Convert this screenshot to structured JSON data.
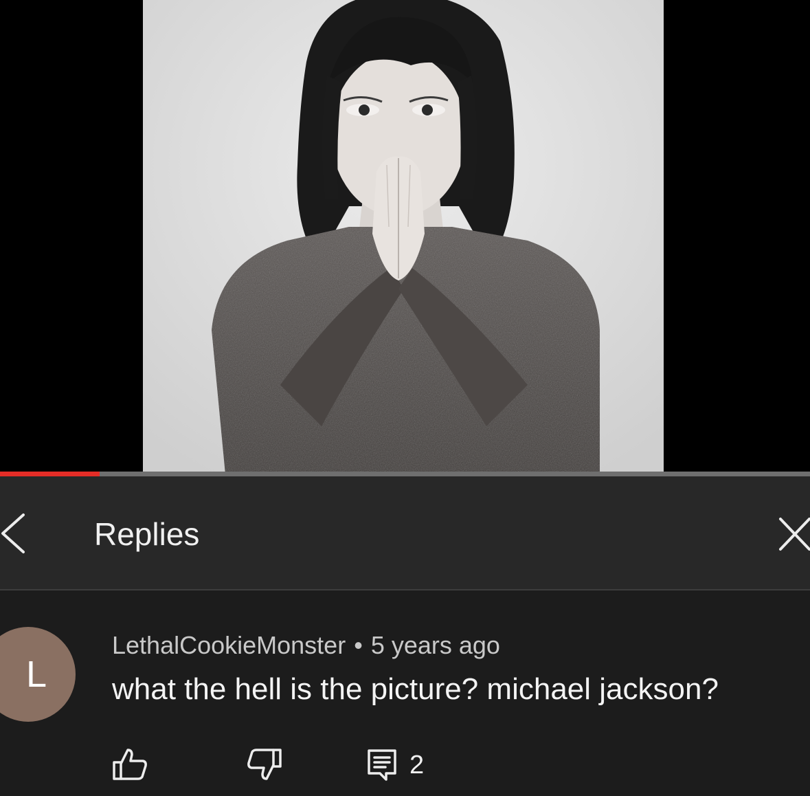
{
  "video": {
    "progress_fraction": 0.123,
    "colors": {
      "played": "#e52d27",
      "track": "#6f6f6f"
    }
  },
  "header": {
    "title": "Replies",
    "back_icon": "chevron-left-icon",
    "close_icon": "close-icon"
  },
  "comment": {
    "avatar_letter": "L",
    "avatar_color": "#8a7062",
    "author": "LethalCookieMonster",
    "separator": "•",
    "time": "5 years ago",
    "text": "what the hell is the picture? michael jackson?",
    "reply_count": "2",
    "icons": [
      "thumb-up-icon",
      "thumb-down-icon",
      "comment-icon"
    ]
  }
}
